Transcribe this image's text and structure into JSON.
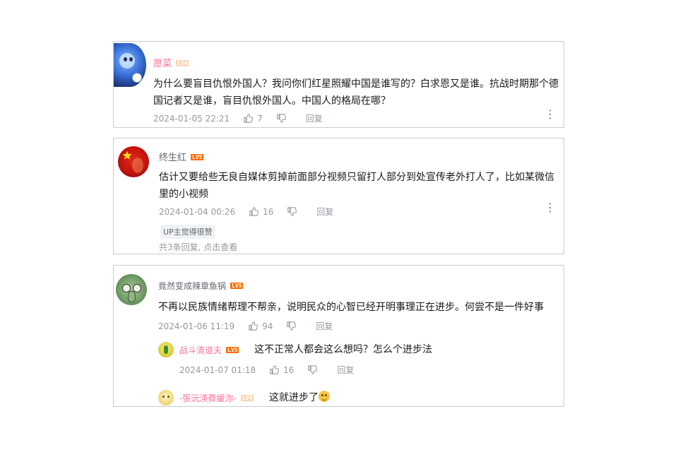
{
  "comments": [
    {
      "username": "愿菜",
      "level": "LV4",
      "text": "为什么要盲目仇恨外国人？我问你们红星照耀中国是谁写的？白求恩又是谁。抗战时期那个德国记者又是谁，盲目仇恨外国人。中国人的格局在哪？",
      "time": "2024-01-05 22:21",
      "likes": "7",
      "reply_label": "回复"
    },
    {
      "username": "终生红",
      "level": "LV5",
      "text": "估计又要给些无良自媒体剪掉前面部分视频只留打人部分到处宣传老外打人了，比如某微信里的小视频",
      "time": "2024-01-04 00:26",
      "likes": "16",
      "reply_label": "回复",
      "tag": "UP主觉得很赞",
      "replies_summary": "共3条回复, 点击查看"
    },
    {
      "username": "竟然变成辣章鱼锅",
      "level": "LV5",
      "text": "不再以民族情绪帮理不帮亲，说明民众的心智已经开明事理正在进步。何尝不是一件好事",
      "time": "2024-01-06 11:19",
      "likes": "94",
      "reply_label": "回复",
      "sub_replies": [
        {
          "username": "战斗清道夫",
          "level": "LV5",
          "text": "这不正常人都会这么想吗？怎么个进步法",
          "time": "2024-01-07 01:18",
          "likes": "16",
          "reply_label": "回复"
        },
        {
          "username": "-張沅渶蕣媛沵-",
          "level": "LV4",
          "text": "这就进步了"
        }
      ]
    }
  ],
  "icons": {
    "like": "thumbs-up-icon",
    "dislike": "thumbs-down-icon",
    "more": "more-vertical-icon",
    "emoji": "emoji-icon"
  },
  "colors": {
    "username_pink": "#fb7299",
    "level_badge": "#ff6c00",
    "meta_grey": "#9499a0"
  }
}
